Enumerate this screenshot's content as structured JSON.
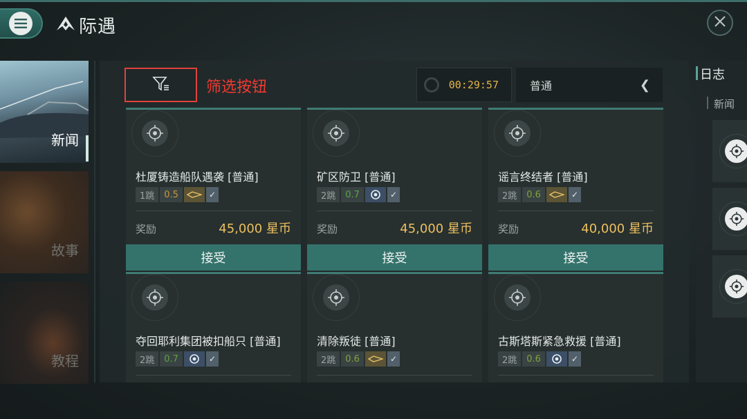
{
  "header": {
    "title": "际遇"
  },
  "left_nav": [
    {
      "label": "新闻",
      "active": true
    },
    {
      "label": "故事",
      "active": false
    },
    {
      "label": "教程",
      "active": false
    }
  ],
  "toolbar": {
    "filter_annotation": "筛选按钮",
    "timer": "00:29:57",
    "difficulty": "普通"
  },
  "cards": [
    {
      "title": "杜厦铸造船队遇袭 [普通]",
      "jumps": "1跳",
      "security": "0.5",
      "security_color": "#c79a3a",
      "type_icon": "ship-icon",
      "reward_label": "奖励",
      "reward": "45,000 星币",
      "accept": "接受"
    },
    {
      "title": "矿区防卫 [普通]",
      "jumps": "2跳",
      "security": "0.7",
      "security_color": "#5aa544",
      "type_icon": "target-icon",
      "reward_label": "奖励",
      "reward": "45,000 星币",
      "accept": "接受"
    },
    {
      "title": "谣言终结者 [普通]",
      "jumps": "2跳",
      "security": "0.6",
      "security_color": "#7fa43e",
      "type_icon": "ship-icon",
      "reward_label": "奖励",
      "reward": "40,000 星币",
      "accept": "接受"
    },
    {
      "title": "夺回耶利集团被扣船只 [普通]",
      "jumps": "2跳",
      "security": "0.7",
      "security_color": "#5aa544",
      "type_icon": "target-icon"
    },
    {
      "title": "清除叛徒 [普通]",
      "jumps": "2跳",
      "security": "0.6",
      "security_color": "#7fa43e",
      "type_icon": "ship-icon"
    },
    {
      "title": "古斯塔斯紧急救援 [普通]",
      "jumps": "2跳",
      "security": "0.6",
      "security_color": "#7fa43e",
      "type_icon": "target-icon"
    }
  ],
  "right_panel": {
    "title": "日志",
    "subtitle": "新闻"
  }
}
